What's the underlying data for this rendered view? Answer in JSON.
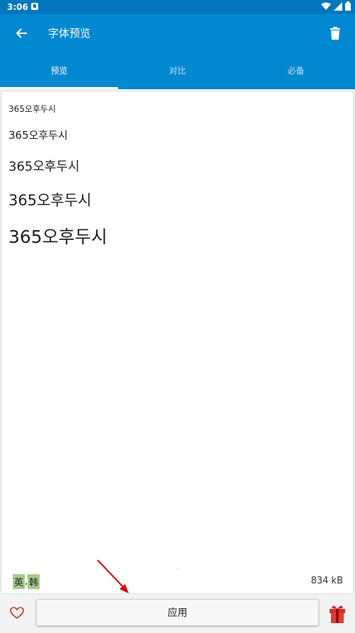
{
  "status": {
    "time": "3:06"
  },
  "app_bar": {
    "title": "字体预览"
  },
  "tabs": [
    {
      "label": "预览",
      "active": true
    },
    {
      "label": "对比",
      "active": false
    },
    {
      "label": "必备",
      "active": false
    }
  ],
  "preview": {
    "samples": [
      "365오후두시",
      "365오후두시",
      "365오후두시",
      "365오후두시",
      "365오후두시"
    ],
    "languages": [
      "英",
      "韩"
    ],
    "language_separator": ",",
    "file_size": "834 kB"
  },
  "bottom": {
    "apply_label": "应用"
  },
  "colors": {
    "primary": "#0288d1",
    "status_bar": "#0277bd",
    "lang_badge": "#a5c98a",
    "arrow": "#e00000"
  },
  "icons": [
    "back-arrow-icon",
    "trash-icon",
    "heart-icon",
    "gift-icon"
  ]
}
